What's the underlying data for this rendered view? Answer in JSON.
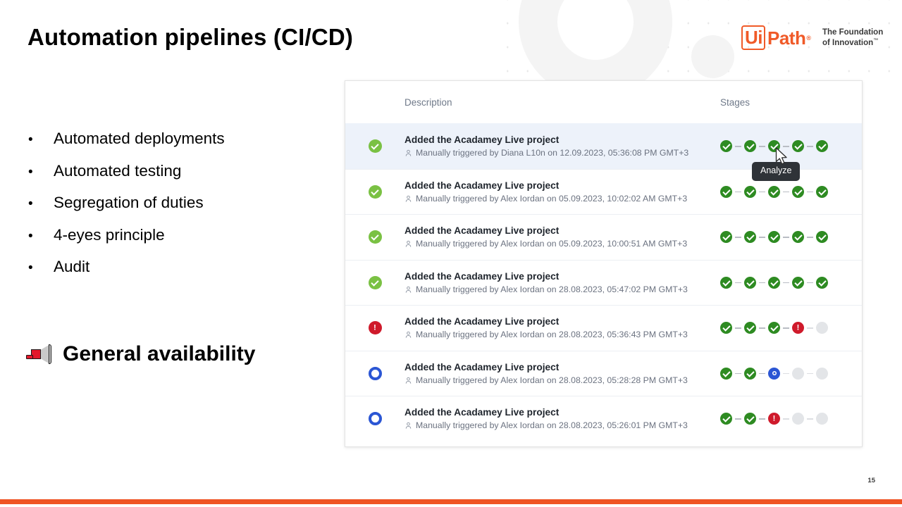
{
  "slide": {
    "title": "Automation pipelines (CI/CD)",
    "page_number": "15",
    "accent_color": "#ef5423"
  },
  "brand": {
    "ui": "Ui",
    "path": "Path",
    "registered": "®",
    "tagline_line1": "The Foundation",
    "tagline_line2": "of Innovation",
    "trademark": "™"
  },
  "bullets": [
    {
      "marker": "•",
      "label": "Automated deployments"
    },
    {
      "marker": "•",
      "label": "Automated testing"
    },
    {
      "marker": "•",
      "label": "Segregation of duties"
    },
    {
      "marker": "•",
      "label": "4-eyes principle"
    },
    {
      "marker": "•",
      "label": "Audit"
    }
  ],
  "callout": {
    "icon": "megaphone-icon",
    "label": "General availability"
  },
  "table": {
    "columns": {
      "description": "Description",
      "stages": "Stages"
    },
    "tooltip": {
      "label": "Analyze",
      "attached_to_stage_index": 2,
      "attached_to_row_index": 0
    },
    "rows": [
      {
        "status": "success",
        "title": "Added the Acadamey Live project",
        "subtitle": "Manually triggered by Diana L10n on 12.09.2023, 05:36:08 PM GMT+3",
        "user_icon": "person-icon",
        "selected": true,
        "stages": [
          "success",
          "success",
          "success",
          "success",
          "success"
        ]
      },
      {
        "status": "success",
        "title": "Added the Acadamey Live project",
        "subtitle": "Manually triggered by Alex Iordan on 05.09.2023, 10:02:02 AM GMT+3",
        "user_icon": "person-icon",
        "selected": false,
        "stages": [
          "success",
          "success",
          "success",
          "success",
          "success"
        ]
      },
      {
        "status": "success",
        "title": "Added the Acadamey Live project",
        "subtitle": "Manually triggered by Alex Iordan on 05.09.2023, 10:00:51 AM GMT+3",
        "user_icon": "person-icon",
        "selected": false,
        "stages": [
          "success",
          "success",
          "success",
          "success",
          "success"
        ]
      },
      {
        "status": "success",
        "title": "Added the Acadamey Live project",
        "subtitle": "Manually triggered by Alex Iordan on 28.08.2023, 05:47:02 PM GMT+3",
        "user_icon": "person-icon",
        "selected": false,
        "stages": [
          "success",
          "success",
          "success",
          "success",
          "success"
        ]
      },
      {
        "status": "error",
        "title": "Added the Acadamey Live project",
        "subtitle": "Manually triggered by Alex Iordan on 28.08.2023, 05:36:43 PM GMT+3",
        "user_icon": "person-icon",
        "selected": false,
        "stages": [
          "success",
          "success",
          "success",
          "error",
          "pending"
        ]
      },
      {
        "status": "running",
        "title": "Added the Acadamey Live project",
        "subtitle": "Manually triggered by Alex Iordan on 28.08.2023, 05:28:28 PM GMT+3",
        "user_icon": "person-icon",
        "selected": false,
        "stages": [
          "success",
          "success",
          "running",
          "pending",
          "pending"
        ]
      },
      {
        "status": "running",
        "title": "Added the Acadamey Live project",
        "subtitle": "Manually triggered by Alex Iordan on 28.08.2023, 05:26:01 PM GMT+3",
        "user_icon": "person-icon",
        "selected": false,
        "stages": [
          "success",
          "success",
          "error",
          "pending",
          "pending"
        ]
      }
    ]
  },
  "status_colors": {
    "success": "#2e8b22",
    "success_soft": "#7ac143",
    "error": "#cf1a2b",
    "running": "#2b56d4",
    "pending": "#e3e5e8"
  }
}
